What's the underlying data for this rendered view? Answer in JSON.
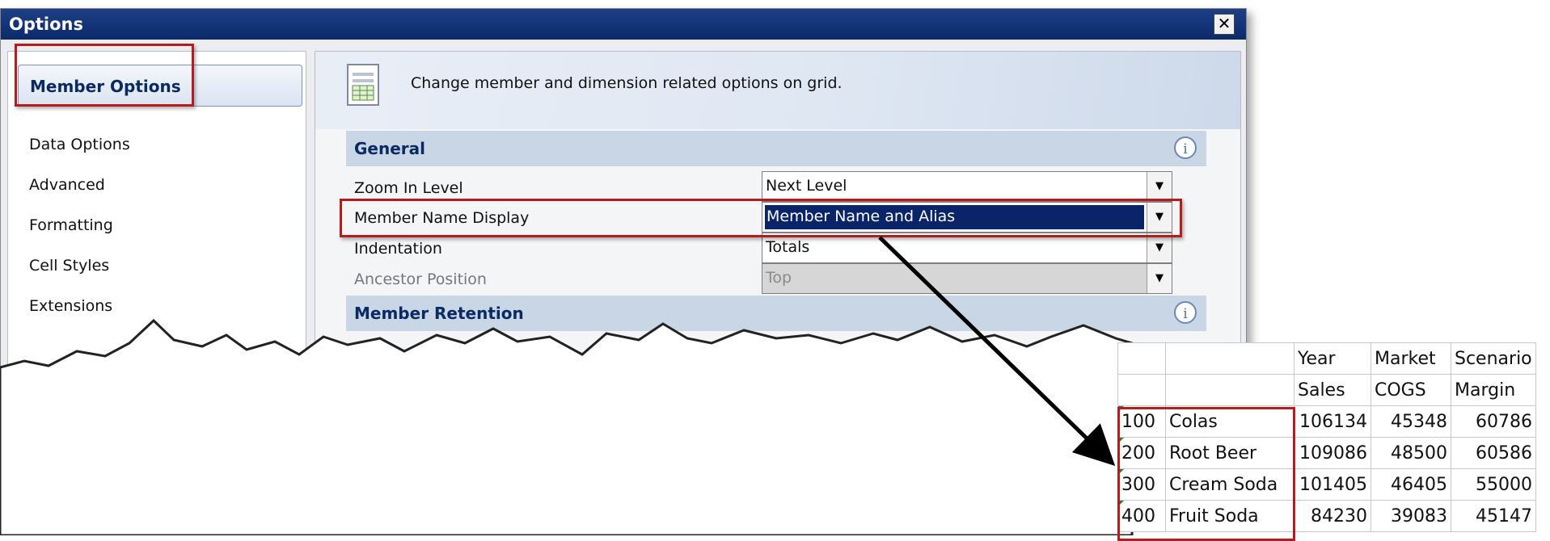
{
  "dialog": {
    "title": "Options",
    "close_label": "✕",
    "nav": [
      {
        "label": "Member Options",
        "selected": true
      },
      {
        "label": "Data Options"
      },
      {
        "label": "Advanced"
      },
      {
        "label": "Formatting"
      },
      {
        "label": "Cell Styles"
      },
      {
        "label": "Extensions"
      }
    ],
    "header_text": "Change member and dimension related options on grid.",
    "sections": {
      "general": "General",
      "retention": "Member Retention"
    },
    "options": [
      {
        "label": "Zoom In Level",
        "value": "Next Level"
      },
      {
        "label": "Member Name Display",
        "value": "Member Name and Alias"
      },
      {
        "label": "Indentation",
        "value": "Totals"
      },
      {
        "label": "Ancestor Position",
        "value": "Top"
      }
    ]
  },
  "sheet": {
    "header_rows": [
      [
        "",
        "",
        "Year",
        "Market",
        "Scenario"
      ],
      [
        "",
        "",
        "Sales",
        "COGS",
        "Margin"
      ]
    ],
    "rows": [
      [
        "100",
        "Colas",
        "106134",
        "45348",
        "60786"
      ],
      [
        "200",
        "Root Beer",
        "109086",
        "48500",
        "60586"
      ],
      [
        "300",
        "Cream Soda",
        "101405",
        "46405",
        "55000"
      ],
      [
        "400",
        "Fruit Soda",
        "84230",
        "39083",
        "45147"
      ]
    ]
  },
  "colors": {
    "highlight": "#b71c1c",
    "titlebar": "#0b2a6b",
    "section_bar": "#c9d6e6"
  }
}
